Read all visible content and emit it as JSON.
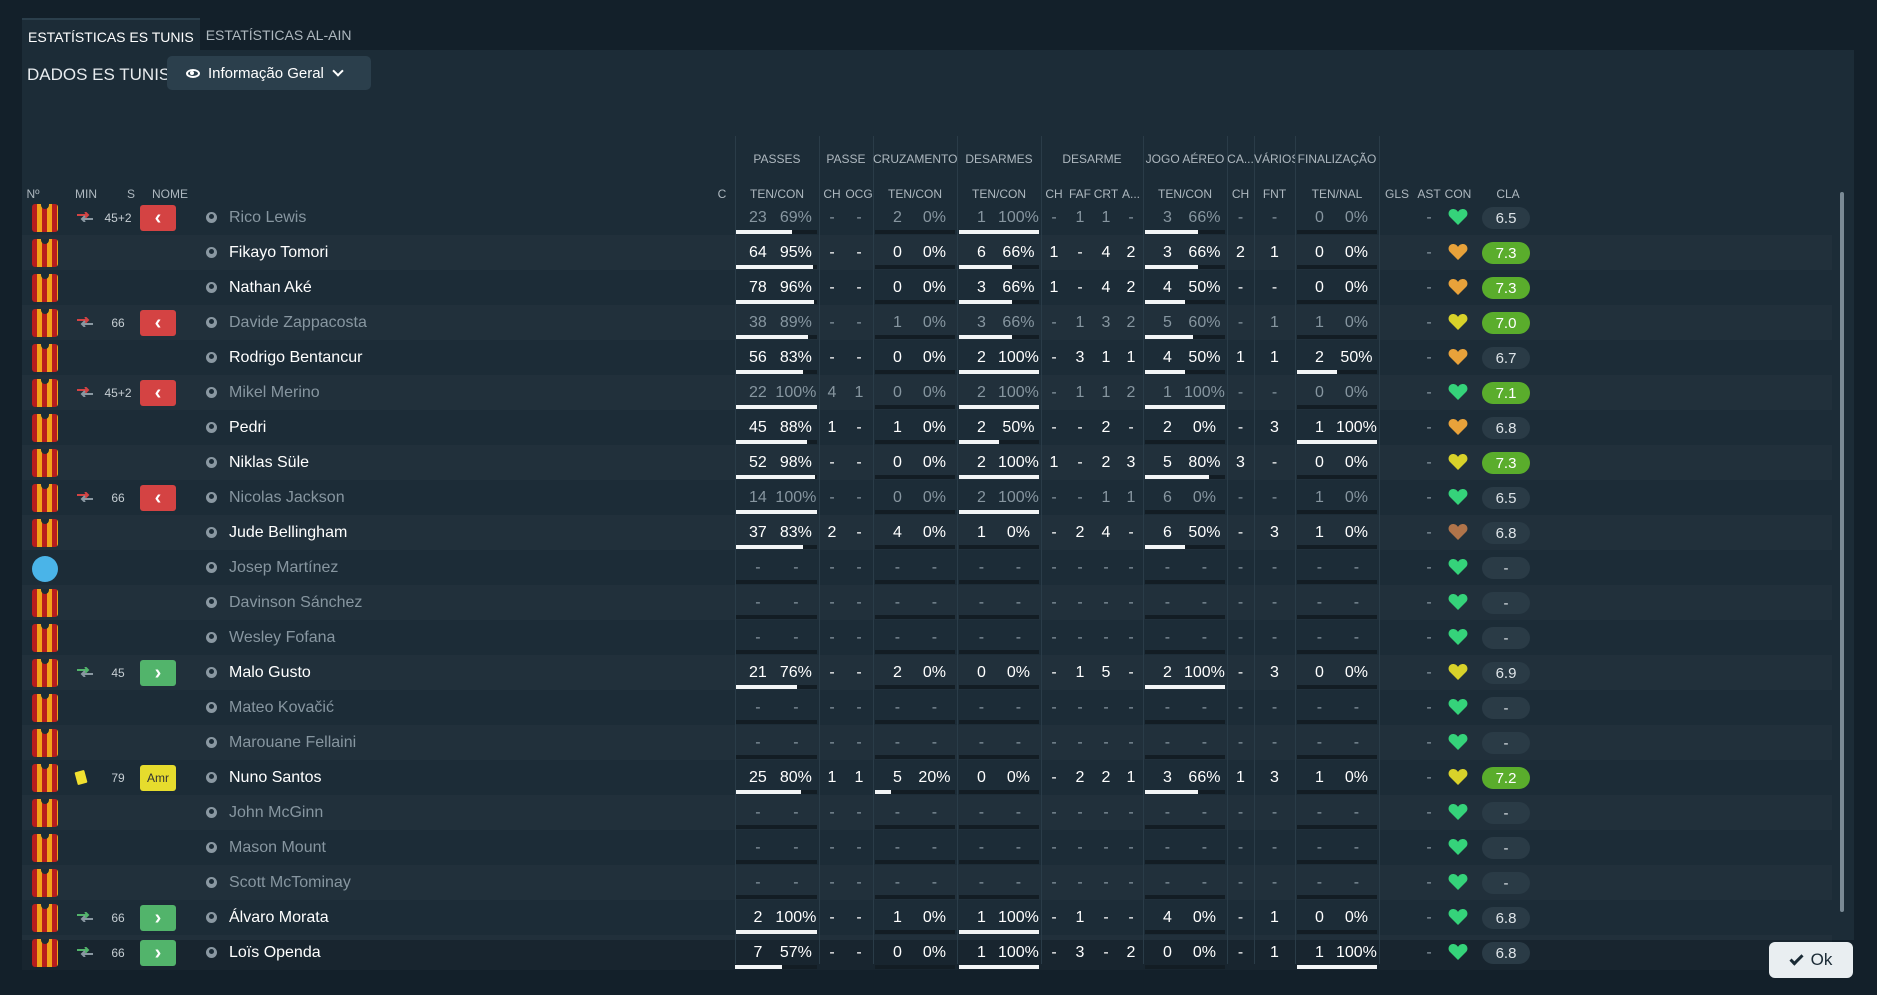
{
  "tabs": [
    "ESTATÍSTICAS ES TUNIS",
    "ESTATÍSTICAS AL-AIN"
  ],
  "section_label": "DADOS ES TUNIS",
  "dropdown_label": "Informação Geral",
  "ok_label": "Ok",
  "groups": [
    "PASSES",
    "PASSE",
    "CRUZAMENTOS",
    "DESARMES",
    "DESARME",
    "JOGO AÉREO",
    "CA...",
    "VÁRIOS",
    "FINALIZAÇÃO"
  ],
  "columns": [
    "Nº",
    "MIN",
    "S",
    "NOME",
    "C",
    "TEN/CON",
    "CH",
    "OCG",
    "TEN/CON",
    "TEN/CON",
    "CH",
    "FAF",
    "CRT",
    "A...",
    "TEN/CON",
    "CH",
    "FNT",
    "TEN/NAL",
    "GLS",
    "AST",
    "CON",
    "CLA"
  ],
  "colors": {
    "heart_green": "#35d37a",
    "heart_yellow": "#d8d22a",
    "heart_orange": "#e8a23a",
    "rating_good": "#5aad2c",
    "sub_out": "#d44343",
    "sub_in": "#52b46b"
  },
  "players": [
    {
      "name": "Rico Lewis",
      "min": "45+2",
      "sub": "out",
      "active": false,
      "passes": [
        "23",
        "69%"
      ],
      "pass_fill": 0.69,
      "passe": [
        "-",
        "-"
      ],
      "cruz": [
        "2",
        "0%"
      ],
      "cruz_fill": 0,
      "des": [
        "1",
        "100%"
      ],
      "des_fill": 1.0,
      "desarme": [
        "-",
        "1",
        "1",
        "-"
      ],
      "aereo": [
        "3",
        "66%"
      ],
      "aereo_fill": 0.66,
      "ca": "-",
      "fnt": "-",
      "fin": [
        "0",
        "0%"
      ],
      "fin_fill": 0,
      "gls": "",
      "ast": "-",
      "con": "green",
      "rating": "6.5",
      "good": false
    },
    {
      "name": "Fikayo Tomori",
      "min": "",
      "sub": "",
      "active": true,
      "passes": [
        "64",
        "95%"
      ],
      "pass_fill": 0.95,
      "passe": [
        "-",
        "-"
      ],
      "cruz": [
        "0",
        "0%"
      ],
      "cruz_fill": 0,
      "des": [
        "6",
        "66%"
      ],
      "des_fill": 0.66,
      "desarme": [
        "1",
        "-",
        "4",
        "2"
      ],
      "aereo": [
        "3",
        "66%"
      ],
      "aereo_fill": 0.66,
      "ca": "2",
      "fnt": "1",
      "fin": [
        "0",
        "0%"
      ],
      "fin_fill": 0,
      "gls": "",
      "ast": "-",
      "con": "orange",
      "rating": "7.3",
      "good": true
    },
    {
      "name": "Nathan Aké",
      "min": "",
      "sub": "",
      "active": true,
      "passes": [
        "78",
        "96%"
      ],
      "pass_fill": 0.96,
      "passe": [
        "-",
        "-"
      ],
      "cruz": [
        "0",
        "0%"
      ],
      "cruz_fill": 0,
      "des": [
        "3",
        "66%"
      ],
      "des_fill": 0.66,
      "desarme": [
        "1",
        "-",
        "4",
        "2"
      ],
      "aereo": [
        "4",
        "50%"
      ],
      "aereo_fill": 0.5,
      "ca": "-",
      "fnt": "-",
      "fin": [
        "0",
        "0%"
      ],
      "fin_fill": 0,
      "gls": "",
      "ast": "-",
      "con": "orange",
      "rating": "7.3",
      "good": true
    },
    {
      "name": "Davide Zappacosta",
      "min": "66",
      "sub": "out",
      "active": false,
      "passes": [
        "38",
        "89%"
      ],
      "pass_fill": 0.89,
      "passe": [
        "-",
        "-"
      ],
      "cruz": [
        "1",
        "0%"
      ],
      "cruz_fill": 0,
      "des": [
        "3",
        "66%"
      ],
      "des_fill": 0.66,
      "desarme": [
        "-",
        "1",
        "3",
        "2"
      ],
      "aereo": [
        "5",
        "60%"
      ],
      "aereo_fill": 0.6,
      "ca": "-",
      "fnt": "1",
      "fin": [
        "1",
        "0%"
      ],
      "fin_fill": 0,
      "gls": "",
      "ast": "-",
      "con": "yellow",
      "rating": "7.0",
      "good": true
    },
    {
      "name": "Rodrigo Bentancur",
      "min": "",
      "sub": "",
      "active": true,
      "passes": [
        "56",
        "83%"
      ],
      "pass_fill": 0.83,
      "passe": [
        "-",
        "-"
      ],
      "cruz": [
        "0",
        "0%"
      ],
      "cruz_fill": 0,
      "des": [
        "2",
        "100%"
      ],
      "des_fill": 1.0,
      "desarme": [
        "-",
        "3",
        "1",
        "1"
      ],
      "aereo": [
        "4",
        "50%"
      ],
      "aereo_fill": 0.5,
      "ca": "1",
      "fnt": "1",
      "fin": [
        "2",
        "50%"
      ],
      "fin_fill": 0.5,
      "gls": "",
      "ast": "-",
      "con": "orange",
      "rating": "6.7",
      "good": false
    },
    {
      "name": "Mikel Merino",
      "min": "45+2",
      "sub": "out",
      "active": false,
      "passes": [
        "22",
        "100%"
      ],
      "pass_fill": 1.0,
      "passe": [
        "4",
        "1"
      ],
      "cruz": [
        "0",
        "0%"
      ],
      "cruz_fill": 0,
      "des": [
        "2",
        "100%"
      ],
      "des_fill": 1.0,
      "desarme": [
        "-",
        "1",
        "1",
        "2"
      ],
      "aereo": [
        "1",
        "100%"
      ],
      "aereo_fill": 1.0,
      "ca": "-",
      "fnt": "-",
      "fin": [
        "0",
        "0%"
      ],
      "fin_fill": 0,
      "gls": "",
      "ast": "-",
      "con": "green",
      "rating": "7.1",
      "good": true
    },
    {
      "name": "Pedri",
      "min": "",
      "sub": "",
      "active": true,
      "passes": [
        "45",
        "88%"
      ],
      "pass_fill": 0.88,
      "passe": [
        "1",
        "-"
      ],
      "cruz": [
        "1",
        "0%"
      ],
      "cruz_fill": 0,
      "des": [
        "2",
        "50%"
      ],
      "des_fill": 0.5,
      "desarme": [
        "-",
        "-",
        "2",
        "-"
      ],
      "aereo": [
        "2",
        "0%"
      ],
      "aereo_fill": 0,
      "ca": "-",
      "fnt": "3",
      "fin": [
        "1",
        "100%"
      ],
      "fin_fill": 1.0,
      "gls": "",
      "ast": "-",
      "con": "orange",
      "rating": "6.8",
      "good": false
    },
    {
      "name": "Niklas Süle",
      "min": "",
      "sub": "",
      "active": true,
      "passes": [
        "52",
        "98%"
      ],
      "pass_fill": 0.98,
      "passe": [
        "-",
        "-"
      ],
      "cruz": [
        "0",
        "0%"
      ],
      "cruz_fill": 0,
      "des": [
        "2",
        "100%"
      ],
      "des_fill": 1.0,
      "desarme": [
        "1",
        "-",
        "2",
        "3"
      ],
      "aereo": [
        "5",
        "80%"
      ],
      "aereo_fill": 0.8,
      "ca": "3",
      "fnt": "-",
      "fin": [
        "0",
        "0%"
      ],
      "fin_fill": 0,
      "gls": "",
      "ast": "-",
      "con": "yellow",
      "rating": "7.3",
      "good": true
    },
    {
      "name": "Nicolas Jackson",
      "min": "66",
      "sub": "out",
      "active": false,
      "passes": [
        "14",
        "100%"
      ],
      "pass_fill": 1.0,
      "passe": [
        "-",
        "-"
      ],
      "cruz": [
        "0",
        "0%"
      ],
      "cruz_fill": 0,
      "des": [
        "2",
        "100%"
      ],
      "des_fill": 1.0,
      "desarme": [
        "-",
        "-",
        "1",
        "1"
      ],
      "aereo": [
        "6",
        "0%"
      ],
      "aereo_fill": 0,
      "ca": "-",
      "fnt": "-",
      "fin": [
        "1",
        "0%"
      ],
      "fin_fill": 0,
      "gls": "",
      "ast": "-",
      "con": "green",
      "rating": "6.5",
      "good": false
    },
    {
      "name": "Jude Bellingham",
      "min": "",
      "sub": "",
      "active": true,
      "passes": [
        "37",
        "83%"
      ],
      "pass_fill": 0.83,
      "passe": [
        "2",
        "-"
      ],
      "cruz": [
        "4",
        "0%"
      ],
      "cruz_fill": 0,
      "des": [
        "1",
        "0%"
      ],
      "des_fill": 0,
      "desarme": [
        "-",
        "2",
        "4",
        "-"
      ],
      "aereo": [
        "6",
        "50%"
      ],
      "aereo_fill": 0.5,
      "ca": "-",
      "fnt": "3",
      "fin": [
        "1",
        "0%"
      ],
      "fin_fill": 0,
      "gls": "",
      "ast": "-",
      "con": "brown",
      "rating": "6.8",
      "good": false
    },
    {
      "name": "Josep Martínez",
      "min": "",
      "sub": "",
      "active": false,
      "gk": true,
      "passes": [
        "-",
        "-"
      ],
      "pass_fill": 0,
      "passe": [
        "-",
        "-"
      ],
      "cruz": [
        "-",
        "-"
      ],
      "cruz_fill": 0,
      "des": [
        "-",
        "-"
      ],
      "des_fill": 0,
      "desarme": [
        "-",
        "-",
        "-",
        "-"
      ],
      "aereo": [
        "-",
        "-"
      ],
      "aereo_fill": 0,
      "ca": "-",
      "fnt": "-",
      "fin": [
        "-",
        "-"
      ],
      "fin_fill": 0,
      "gls": "",
      "ast": "-",
      "con": "green",
      "rating": "-",
      "good": false
    },
    {
      "name": "Davinson Sánchez",
      "min": "",
      "sub": "",
      "active": false,
      "passes": [
        "-",
        "-"
      ],
      "pass_fill": 0,
      "passe": [
        "-",
        "-"
      ],
      "cruz": [
        "-",
        "-"
      ],
      "cruz_fill": 0,
      "des": [
        "-",
        "-"
      ],
      "des_fill": 0,
      "desarme": [
        "-",
        "-",
        "-",
        "-"
      ],
      "aereo": [
        "-",
        "-"
      ],
      "aereo_fill": 0,
      "ca": "-",
      "fnt": "-",
      "fin": [
        "-",
        "-"
      ],
      "fin_fill": 0,
      "gls": "",
      "ast": "-",
      "con": "green",
      "rating": "-",
      "good": false
    },
    {
      "name": "Wesley Fofana",
      "min": "",
      "sub": "",
      "active": false,
      "passes": [
        "-",
        "-"
      ],
      "pass_fill": 0,
      "passe": [
        "-",
        "-"
      ],
      "cruz": [
        "-",
        "-"
      ],
      "cruz_fill": 0,
      "des": [
        "-",
        "-"
      ],
      "des_fill": 0,
      "desarme": [
        "-",
        "-",
        "-",
        "-"
      ],
      "aereo": [
        "-",
        "-"
      ],
      "aereo_fill": 0,
      "ca": "-",
      "fnt": "-",
      "fin": [
        "-",
        "-"
      ],
      "fin_fill": 0,
      "gls": "",
      "ast": "-",
      "con": "green",
      "rating": "-",
      "good": false
    },
    {
      "name": "Malo Gusto",
      "min": "45",
      "sub": "in",
      "active": true,
      "passes": [
        "21",
        "76%"
      ],
      "pass_fill": 0.76,
      "passe": [
        "-",
        "-"
      ],
      "cruz": [
        "2",
        "0%"
      ],
      "cruz_fill": 0,
      "des": [
        "0",
        "0%"
      ],
      "des_fill": 0,
      "desarme": [
        "-",
        "1",
        "5",
        "-"
      ],
      "aereo": [
        "2",
        "100%"
      ],
      "aereo_fill": 1.0,
      "ca": "-",
      "fnt": "3",
      "fin": [
        "0",
        "0%"
      ],
      "fin_fill": 0,
      "gls": "",
      "ast": "-",
      "con": "yellow",
      "rating": "6.9",
      "good": false
    },
    {
      "name": "Mateo Kovačić",
      "min": "",
      "sub": "",
      "active": false,
      "passes": [
        "-",
        "-"
      ],
      "pass_fill": 0,
      "passe": [
        "-",
        "-"
      ],
      "cruz": [
        "-",
        "-"
      ],
      "cruz_fill": 0,
      "des": [
        "-",
        "-"
      ],
      "des_fill": 0,
      "desarme": [
        "-",
        "-",
        "-",
        "-"
      ],
      "aereo": [
        "-",
        "-"
      ],
      "aereo_fill": 0,
      "ca": "-",
      "fnt": "-",
      "fin": [
        "-",
        "-"
      ],
      "fin_fill": 0,
      "gls": "",
      "ast": "-",
      "con": "green",
      "rating": "-",
      "good": false
    },
    {
      "name": "Marouane Fellaini",
      "min": "",
      "sub": "",
      "active": false,
      "passes": [
        "-",
        "-"
      ],
      "pass_fill": 0,
      "passe": [
        "-",
        "-"
      ],
      "cruz": [
        "-",
        "-"
      ],
      "cruz_fill": 0,
      "des": [
        "-",
        "-"
      ],
      "des_fill": 0,
      "desarme": [
        "-",
        "-",
        "-",
        "-"
      ],
      "aereo": [
        "-",
        "-"
      ],
      "aereo_fill": 0,
      "ca": "-",
      "fnt": "-",
      "fin": [
        "-",
        "-"
      ],
      "fin_fill": 0,
      "gls": "",
      "ast": "-",
      "con": "green",
      "rating": "-",
      "good": false
    },
    {
      "name": "Nuno Santos",
      "min": "79",
      "sub": "amr",
      "card": true,
      "active": true,
      "passes": [
        "25",
        "80%"
      ],
      "pass_fill": 0.8,
      "passe": [
        "1",
        "1"
      ],
      "cruz": [
        "5",
        "20%"
      ],
      "cruz_fill": 0.2,
      "des": [
        "0",
        "0%"
      ],
      "des_fill": 0,
      "desarme": [
        "-",
        "2",
        "2",
        "1"
      ],
      "aereo": [
        "3",
        "66%"
      ],
      "aereo_fill": 0.66,
      "ca": "1",
      "fnt": "3",
      "fin": [
        "1",
        "0%"
      ],
      "fin_fill": 0,
      "gls": "",
      "ast": "-",
      "con": "yellow",
      "rating": "7.2",
      "good": true
    },
    {
      "name": "John McGinn",
      "min": "",
      "sub": "",
      "active": false,
      "passes": [
        "-",
        "-"
      ],
      "pass_fill": 0,
      "passe": [
        "-",
        "-"
      ],
      "cruz": [
        "-",
        "-"
      ],
      "cruz_fill": 0,
      "des": [
        "-",
        "-"
      ],
      "des_fill": 0,
      "desarme": [
        "-",
        "-",
        "-",
        "-"
      ],
      "aereo": [
        "-",
        "-"
      ],
      "aereo_fill": 0,
      "ca": "-",
      "fnt": "-",
      "fin": [
        "-",
        "-"
      ],
      "fin_fill": 0,
      "gls": "",
      "ast": "-",
      "con": "green",
      "rating": "-",
      "good": false
    },
    {
      "name": "Mason Mount",
      "min": "",
      "sub": "",
      "active": false,
      "passes": [
        "-",
        "-"
      ],
      "pass_fill": 0,
      "passe": [
        "-",
        "-"
      ],
      "cruz": [
        "-",
        "-"
      ],
      "cruz_fill": 0,
      "des": [
        "-",
        "-"
      ],
      "des_fill": 0,
      "desarme": [
        "-",
        "-",
        "-",
        "-"
      ],
      "aereo": [
        "-",
        "-"
      ],
      "aereo_fill": 0,
      "ca": "-",
      "fnt": "-",
      "fin": [
        "-",
        "-"
      ],
      "fin_fill": 0,
      "gls": "",
      "ast": "-",
      "con": "green",
      "rating": "-",
      "good": false
    },
    {
      "name": "Scott McTominay",
      "min": "",
      "sub": "",
      "active": false,
      "passes": [
        "-",
        "-"
      ],
      "pass_fill": 0,
      "passe": [
        "-",
        "-"
      ],
      "cruz": [
        "-",
        "-"
      ],
      "cruz_fill": 0,
      "des": [
        "-",
        "-"
      ],
      "des_fill": 0,
      "desarme": [
        "-",
        "-",
        "-",
        "-"
      ],
      "aereo": [
        "-",
        "-"
      ],
      "aereo_fill": 0,
      "ca": "-",
      "fnt": "-",
      "fin": [
        "-",
        "-"
      ],
      "fin_fill": 0,
      "gls": "",
      "ast": "-",
      "con": "green",
      "rating": "-",
      "good": false
    },
    {
      "name": "Álvaro Morata",
      "min": "66",
      "sub": "in",
      "active": true,
      "passes": [
        "2",
        "100%"
      ],
      "pass_fill": 1.0,
      "passe": [
        "-",
        "-"
      ],
      "cruz": [
        "1",
        "0%"
      ],
      "cruz_fill": 0,
      "des": [
        "1",
        "100%"
      ],
      "des_fill": 1.0,
      "desarme": [
        "-",
        "1",
        "-",
        "-"
      ],
      "aereo": [
        "4",
        "0%"
      ],
      "aereo_fill": 0,
      "ca": "-",
      "fnt": "1",
      "fin": [
        "0",
        "0%"
      ],
      "fin_fill": 0,
      "gls": "",
      "ast": "-",
      "con": "green",
      "rating": "6.8",
      "good": false
    },
    {
      "name": "Loïs Openda",
      "min": "66",
      "sub": "in",
      "active": true,
      "passes": [
        "7",
        "57%"
      ],
      "pass_fill": 0.57,
      "passe": [
        "-",
        "-"
      ],
      "cruz": [
        "0",
        "0%"
      ],
      "cruz_fill": 0,
      "des": [
        "1",
        "100%"
      ],
      "des_fill": 1.0,
      "desarme": [
        "-",
        "3",
        "-",
        "2"
      ],
      "aereo": [
        "0",
        "0%"
      ],
      "aereo_fill": 0,
      "ca": "-",
      "fnt": "1",
      "fin": [
        "1",
        "100%"
      ],
      "fin_fill": 1.0,
      "gls": "",
      "ast": "-",
      "con": "green",
      "rating": "6.8",
      "good": false
    }
  ]
}
